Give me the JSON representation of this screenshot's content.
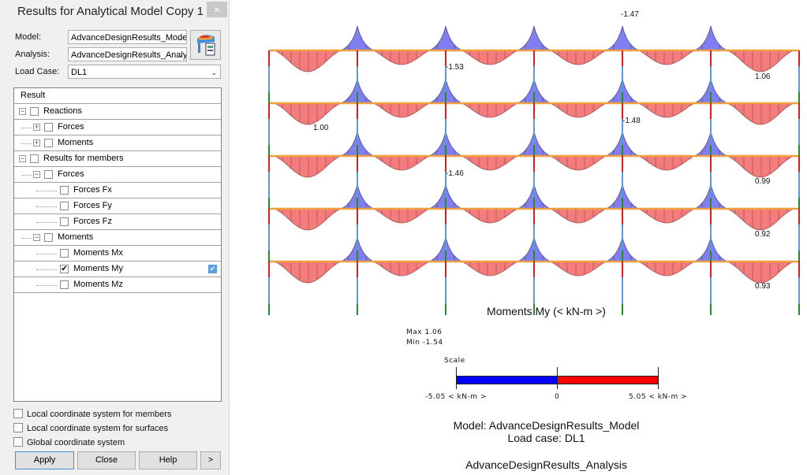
{
  "dialog": {
    "title": "Results for Analytical Model Copy 1 |",
    "close": "×",
    "model_label": "Model:",
    "model_value": "AdvanceDesignResults_Mode",
    "analysis_label": "Analysis:",
    "analysis_value": "AdvanceDesignResults_Analy",
    "loadcase_label": "Load Case:",
    "loadcase_value": "DL1",
    "tree_header": "Result",
    "tree": [
      {
        "label": "Reactions",
        "level": 0,
        "expander": "−",
        "checked": false
      },
      {
        "label": "Forces",
        "level": 1,
        "expander": "+",
        "checked": false
      },
      {
        "label": "Moments",
        "level": 1,
        "expander": "+",
        "checked": false
      },
      {
        "label": "Results for members",
        "level": 0,
        "expander": "−",
        "checked": false
      },
      {
        "label": "Forces",
        "level": 1,
        "expander": "−",
        "checked": false
      },
      {
        "label": "Forces Fx",
        "level": 2,
        "expander": "",
        "checked": false
      },
      {
        "label": "Forces Fy",
        "level": 2,
        "expander": "",
        "checked": false
      },
      {
        "label": "Forces Fz",
        "level": 2,
        "expander": "",
        "checked": false
      },
      {
        "label": "Moments",
        "level": 1,
        "expander": "−",
        "checked": false
      },
      {
        "label": "Moments Mx",
        "level": 2,
        "expander": "",
        "checked": false
      },
      {
        "label": "Moments My",
        "level": 2,
        "expander": "",
        "checked": true
      },
      {
        "label": "Moments Mz",
        "level": 2,
        "expander": "",
        "checked": false
      }
    ],
    "options": [
      "Local coordinate system for members",
      "Local coordinate system for surfaces",
      "Global coordinate system"
    ],
    "buttons": {
      "apply": "Apply",
      "close": "Close",
      "help": "Help",
      "more": ">"
    }
  },
  "diagram": {
    "title": "Moments My (< kN-m >)",
    "max": "Max 1.06",
    "min": "Min -1.54",
    "scale_label": "Scale",
    "scale_min": "-5.05 < kN-m >",
    "scale_mid": "0",
    "scale_max": "5.05 < kN-m >",
    "negative_color": "#0000ff",
    "positive_color": "#ff0000",
    "annotations": [
      "-1.47",
      "-1.53",
      "1.06",
      "1.00",
      "-1.48",
      "-1.46",
      "0.99",
      "0.92",
      "0.93"
    ],
    "model_line": "Model: AdvanceDesignResults_Model",
    "loadcase_line": "Load case: DL1",
    "analysis_line": "AdvanceDesignResults_Analysis"
  }
}
